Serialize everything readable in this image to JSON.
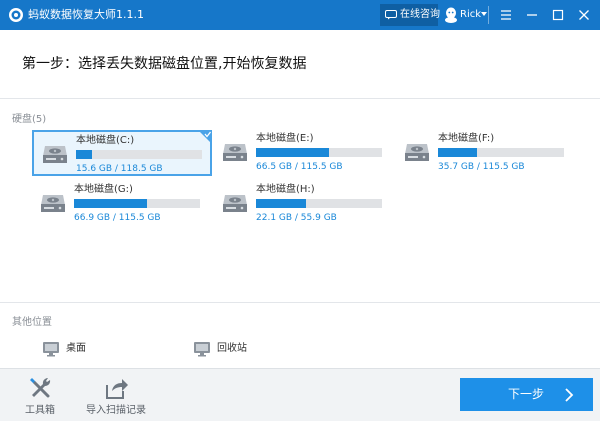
{
  "titlebar": {
    "title": "蚂蚁数据恢复大师1.1.1",
    "online_label": "在线咨询",
    "user_name": "Rick"
  },
  "step": {
    "title": "第一步：选择丢失数据磁盘位置,开始恢复数据"
  },
  "disks_section": {
    "label": "硬盘(5)"
  },
  "disks": [
    {
      "name": "本地磁盘(C:)",
      "size": "15.6 GB / 118.5 GB",
      "used_fraction": 0.13,
      "selected": true
    },
    {
      "name": "本地磁盘(E:)",
      "size": "66.5 GB / 115.5 GB",
      "used_fraction": 0.58,
      "selected": false
    },
    {
      "name": "本地磁盘(F:)",
      "size": "35.7 GB / 115.5 GB",
      "used_fraction": 0.31,
      "selected": false
    },
    {
      "name": "本地磁盘(G:)",
      "size": "66.9 GB / 115.5 GB",
      "used_fraction": 0.58,
      "selected": false
    },
    {
      "name": "本地磁盘(H:)",
      "size": "22.1 GB / 55.9 GB",
      "used_fraction": 0.4,
      "selected": false
    }
  ],
  "other_section": {
    "label": "其他位置"
  },
  "locations": [
    {
      "label": "桌面",
      "icon": "monitor-icon"
    },
    {
      "label": "回收站",
      "icon": "monitor-icon"
    }
  ],
  "footer": {
    "toolbox_label": "工具箱",
    "import_label": "导入扫描记录",
    "next_label": "下一步"
  },
  "colors": {
    "titlebar": "#1677c9",
    "accent": "#1a88d8",
    "selected_bg": "#eaf5fd",
    "next_button": "#1e90e8"
  }
}
